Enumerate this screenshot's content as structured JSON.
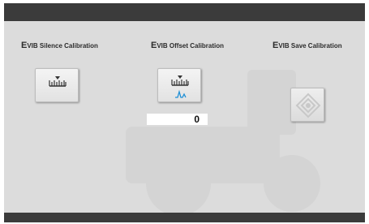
{
  "calibrations": [
    {
      "prefix": "E",
      "label": "VIB Silence Calibration",
      "icon": "ruler-icon"
    },
    {
      "prefix": "E",
      "label": "VIB Offset Calibration",
      "icon": "ruler-wave-icon"
    },
    {
      "prefix": "E",
      "label": "VIB Save Calibration",
      "icon": "save-diamond-icon"
    }
  ],
  "offset_value": "0",
  "colors": {
    "bar": "#3b3b3b",
    "panel": "#dcdcdc",
    "wave": "#1e8fd6"
  }
}
